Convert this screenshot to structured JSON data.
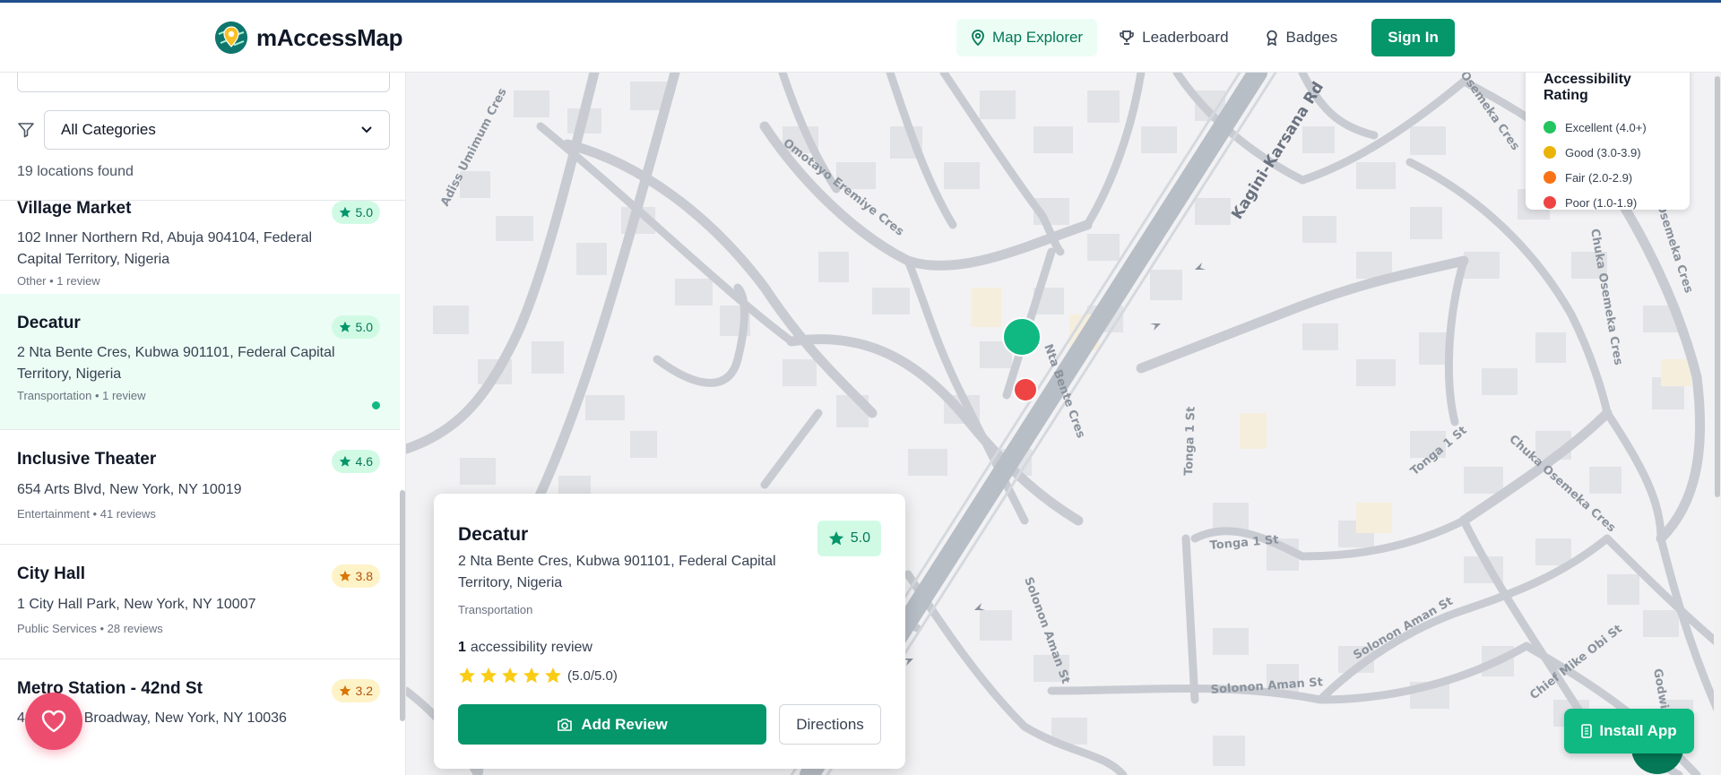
{
  "app": {
    "name": "mAccessMap"
  },
  "nav": {
    "items": [
      {
        "label": "Map Explorer",
        "icon": "map-pin-icon",
        "active": true
      },
      {
        "label": "Leaderboard",
        "icon": "trophy-icon",
        "active": false
      },
      {
        "label": "Badges",
        "icon": "award-icon",
        "active": false
      }
    ],
    "signin_label": "Sign In"
  },
  "sidebar": {
    "search": {
      "placeholder": ""
    },
    "category_select": {
      "value": "All Categories"
    },
    "count_text": "19 locations found",
    "locations": [
      {
        "name": "Village Market",
        "rating": "5.0",
        "rating_color": "green",
        "address": "102 Inner Northern Rd, Abuja 904104, Federal Capital Territory, Nigeria",
        "meta": "Other • 1 review",
        "selected": false
      },
      {
        "name": "Decatur",
        "rating": "5.0",
        "rating_color": "green",
        "address": "2 Nta Bente Cres, Kubwa 901101, Federal Capital Territory, Nigeria",
        "meta": "Transportation • 1 review",
        "selected": true
      },
      {
        "name": "Inclusive Theater",
        "rating": "4.6",
        "rating_color": "green",
        "address": "654 Arts Blvd, New York, NY 10019",
        "meta": "Entertainment • 41 reviews",
        "selected": false
      },
      {
        "name": "City Hall",
        "rating": "3.8",
        "rating_color": "yellow",
        "address": "1 City Hall Park, New York, NY 10007",
        "meta": "Public Services • 28 reviews",
        "selected": false
      },
      {
        "name": "Metro Station - 42nd St",
        "rating": "3.2",
        "rating_color": "yellow",
        "address": "42nd St & Broadway, New York, NY 10036",
        "meta": "",
        "selected": false
      }
    ]
  },
  "map": {
    "street_labels": [
      "Adiss Umimum Cres",
      "Omotayo Eremiye Cres",
      "Kagini-Karsana Rd",
      "Nta Bente Cres",
      "Tonga 1 St",
      "Tonga 1 St",
      "Tonga 1 St",
      "Chuka Osemeka Cres",
      "Chuka Osemeka Cres",
      "Chuka Osemeka Cres",
      "Solonon Aman St",
      "Solonon Aman St",
      "Solonon Aman St",
      "Chief Mike Obi St",
      "Osemeka Cres",
      "Godwin"
    ],
    "markers": [
      {
        "status": "excellent",
        "color": "#10b981"
      },
      {
        "status": "poor",
        "color": "#ef4444"
      }
    ]
  },
  "legend": {
    "title": "Accessibility Rating",
    "items": [
      {
        "label": "Excellent (4.0+)",
        "color": "#22c55e"
      },
      {
        "label": "Good (3.0-3.9)",
        "color": "#eab308"
      },
      {
        "label": "Fair (2.0-2.9)",
        "color": "#f97316"
      },
      {
        "label": "Poor (1.0-1.9)",
        "color": "#ef4444"
      }
    ]
  },
  "popup": {
    "name": "Decatur",
    "rating": "5.0",
    "address": "2 Nta Bente Cres, Kubwa 901101, Federal Capital Territory, Nigeria",
    "category": "Transportation",
    "review_count": "1",
    "review_label": "accessibility review",
    "stars": 5,
    "score_text": "(5.0/5.0)",
    "add_review_label": "Add Review",
    "directions_label": "Directions"
  },
  "install_label": "Install App",
  "colors": {
    "brand": "#059669",
    "accent_bar": "#1f4e8c",
    "favorite": "#ec4d6e"
  }
}
